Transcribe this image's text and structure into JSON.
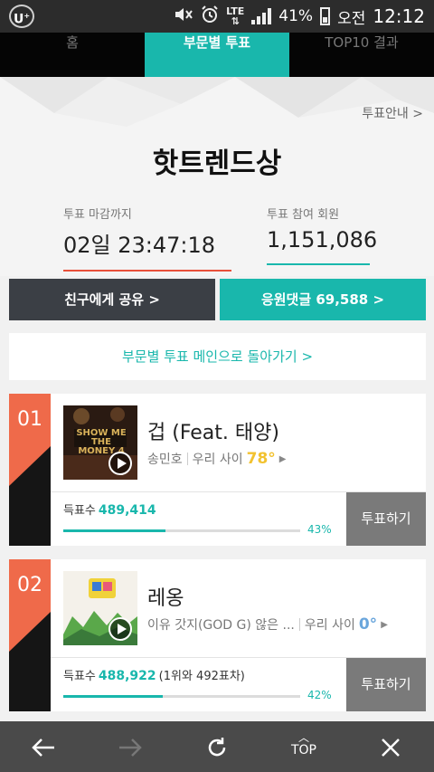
{
  "status": {
    "battery": "41%",
    "lte": "LTE",
    "ampm": "오전",
    "time": "12:12"
  },
  "tabs": [
    {
      "label": "홈"
    },
    {
      "label": "부문별 투표",
      "active": true
    },
    {
      "label": "TOP10 결과"
    }
  ],
  "header": {
    "guide_link": "투표안내 >",
    "title": "핫트렌드상",
    "deadline_label": "투표 마감까지",
    "deadline_value": "02일 23:47:18",
    "participants_label": "투표 참여 회원",
    "participants_value": "1,151,086",
    "colors": {
      "deadline_line": "#e8503a",
      "participants_line": "#19b7ac"
    }
  },
  "actions": {
    "share": "친구에게 공유 >",
    "comments": "응원댓글 69,588 >",
    "back_to_main": "부문별 투표 메인으로 돌아가기 >"
  },
  "songs": [
    {
      "rank": "01",
      "title": "겁 (Feat. 태양)",
      "artist": "송민호",
      "relation_label": "우리 사이",
      "degree": "78°",
      "degree_color": "#f2c230",
      "votes_label": "득표수",
      "votes": "489,414",
      "diff": "",
      "share_fraction": 0.43,
      "percent": "43%",
      "vote_button": "투표하기",
      "album_art_text": "SHOW ME THE MONEY 4"
    },
    {
      "rank": "02",
      "title": "레옹",
      "artist": "이유 갓지(GOD G) 않은 ...",
      "relation_label": "우리 사이",
      "degree": "0°",
      "degree_color": "#6aa6dc",
      "votes_label": "득표수",
      "votes": "488,922",
      "diff": "(1위와 492표차)",
      "share_fraction": 0.42,
      "percent": "42%",
      "vote_button": "투표하기"
    }
  ],
  "bottom_nav": {
    "back": "back-arrow",
    "forward": "forward-arrow",
    "refresh": "refresh",
    "top_label": "TOP",
    "close": "close"
  },
  "accent_color": "#19b7ac"
}
